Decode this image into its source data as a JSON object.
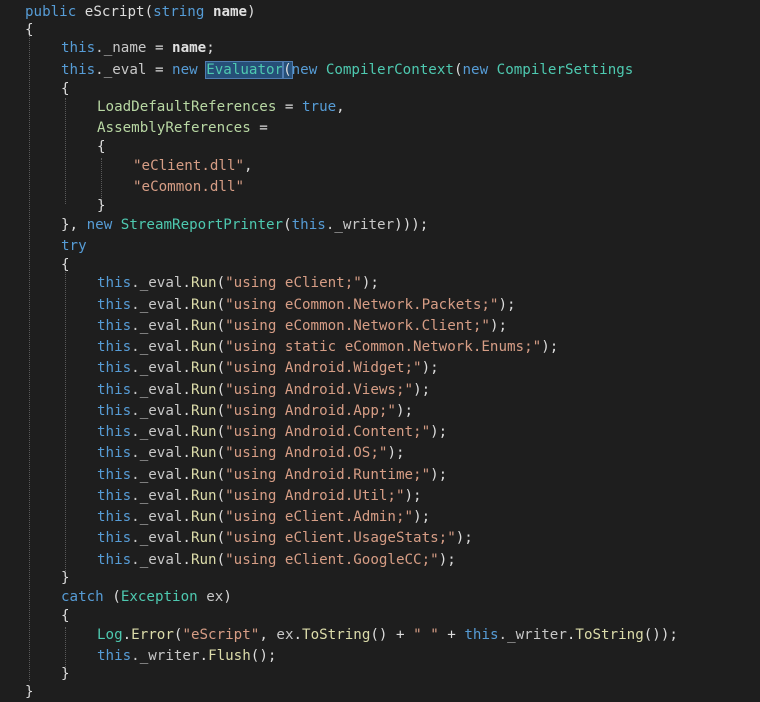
{
  "code": {
    "l1_kw": "public",
    "l1_method": "eScript",
    "l1_open": "(",
    "l1_type": "string",
    "l1_param": "name",
    "l1_close": ")",
    "brace_open": "{",
    "brace_close": "}",
    "this_kw": "this",
    "name_field": "._name",
    "eq": " = ",
    "name_param": "name",
    "semicolon": ";",
    "eval_field": "._eval",
    "new_kw": "new",
    "evaluator": "Evaluator",
    "compiler_context": "CompilerContext",
    "compiler_settings": "CompilerSettings",
    "load_default_refs": "LoadDefaultReferences",
    "true_kw": "true",
    "comma": ",",
    "assembly_refs": "AssemblyReferences",
    "ref1": "\"eClient.dll\"",
    "ref2": "\"eCommon.dll\"",
    "close_new": "}, ",
    "stream_printer": "StreamReportPrinter",
    "writer_field": "._writer",
    "close_tail": ")));",
    "try_kw": "try",
    "run_method": "Run",
    "usings": [
      "\"using eClient;\"",
      "\"using eCommon.Network.Packets;\"",
      "\"using eCommon.Network.Client;\"",
      "\"using static eCommon.Network.Enums;\"",
      "\"using Android.Widget;\"",
      "\"using Android.Views;\"",
      "\"using Android.App;\"",
      "\"using Android.Content;\"",
      "\"using Android.OS;\"",
      "\"using Android.Runtime;\"",
      "\"using Android.Util;\"",
      "\"using eClient.Admin;\"",
      "\"using eClient.UsageStats;\"",
      "\"using eClient.GoogleCC;\""
    ],
    "catch_kw": "catch",
    "exception_type": "Exception",
    "ex_var": "ex",
    "log_class": "Log",
    "error_method": "Error",
    "escript_str": "\"eScript\"",
    "tostring_method": "ToString",
    "plus": " + ",
    "space_str": "\" \"",
    "flush_method": "Flush"
  }
}
